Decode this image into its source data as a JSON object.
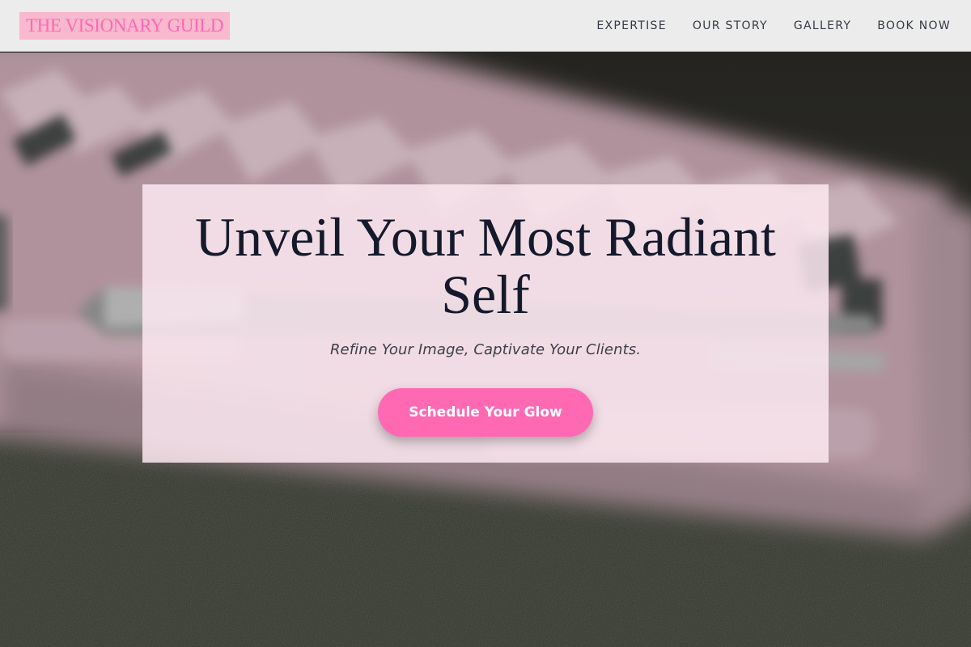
{
  "header": {
    "logo_text": "THE VISIONARY GUILD",
    "nav": [
      {
        "label": "EXPERTISE"
      },
      {
        "label": "OUR STORY"
      },
      {
        "label": "GALLERY"
      },
      {
        "label": "BOOK NOW"
      }
    ]
  },
  "hero": {
    "headline": "Unveil Your Most Radiant Self",
    "subheadline": "Refine Your Image, Captivate Your Clients.",
    "cta_label": "Schedule Your Glow"
  },
  "colors": {
    "accent": "#ff69b4",
    "logo_bg": "#f8b8cd",
    "header_bg": "#ececec",
    "headline_text": "#141a2b",
    "card_bg": "#fbe8f0"
  }
}
